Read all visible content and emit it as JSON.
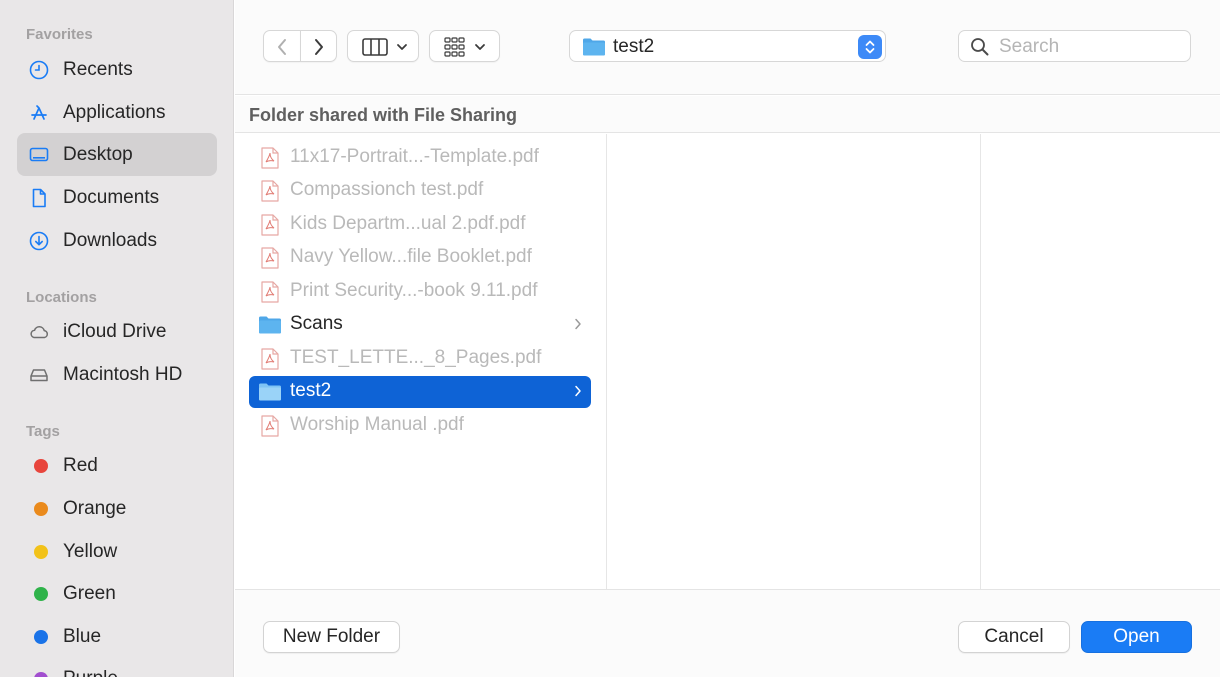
{
  "sidebar": {
    "favorites_header": "Favorites",
    "favorites": [
      {
        "label": "Recents",
        "icon": "clock-icon",
        "selected": false
      },
      {
        "label": "Applications",
        "icon": "applications-icon",
        "selected": false
      },
      {
        "label": "Desktop",
        "icon": "desktop-icon",
        "selected": true
      },
      {
        "label": "Documents",
        "icon": "document-icon",
        "selected": false
      },
      {
        "label": "Downloads",
        "icon": "download-icon",
        "selected": false
      }
    ],
    "locations_header": "Locations",
    "locations": [
      {
        "label": "iCloud Drive",
        "icon": "cloud-icon"
      },
      {
        "label": "Macintosh HD",
        "icon": "disk-icon"
      }
    ],
    "tags_header": "Tags",
    "tags": [
      {
        "label": "Red",
        "color": "#e8453c"
      },
      {
        "label": "Orange",
        "color": "#ea8a1c"
      },
      {
        "label": "Yellow",
        "color": "#f2c219"
      },
      {
        "label": "Green",
        "color": "#2fb34a"
      },
      {
        "label": "Blue",
        "color": "#1a73e8"
      },
      {
        "label": "Purple",
        "color": "#a24fcf"
      }
    ]
  },
  "toolbar": {
    "back_icon": "chevron-left-icon",
    "forward_icon": "chevron-right-icon",
    "view_icon": "columns-view-icon",
    "group_icon": "grid-group-icon",
    "path": "test2",
    "search_placeholder": "Search"
  },
  "subheader": "Folder shared with File Sharing",
  "files": [
    {
      "name": "11x17-Portrait...-Template.pdf",
      "type": "pdf",
      "enabled": false
    },
    {
      "name": "Compassionch test.pdf",
      "type": "pdf",
      "enabled": false
    },
    {
      "name": "Kids Departm...ual   2.pdf.pdf",
      "type": "pdf",
      "enabled": false
    },
    {
      "name": "Navy Yellow...file Booklet.pdf",
      "type": "pdf",
      "enabled": false
    },
    {
      "name": "Print Security...-book 9.11.pdf",
      "type": "pdf",
      "enabled": false
    },
    {
      "name": "Scans",
      "type": "folder",
      "enabled": true,
      "selected": false
    },
    {
      "name": "TEST_LETTE..._8_Pages.pdf",
      "type": "pdf",
      "enabled": false
    },
    {
      "name": "test2",
      "type": "folder",
      "enabled": true,
      "selected": true
    },
    {
      "name": "Worship Manual .pdf",
      "type": "pdf",
      "enabled": false
    }
  ],
  "buttons": {
    "new_folder": "New Folder",
    "cancel": "Cancel",
    "open": "Open"
  },
  "colors": {
    "accent": "#1a7cf5",
    "selection": "#0e63d6",
    "folder": "#4fa7e8"
  }
}
